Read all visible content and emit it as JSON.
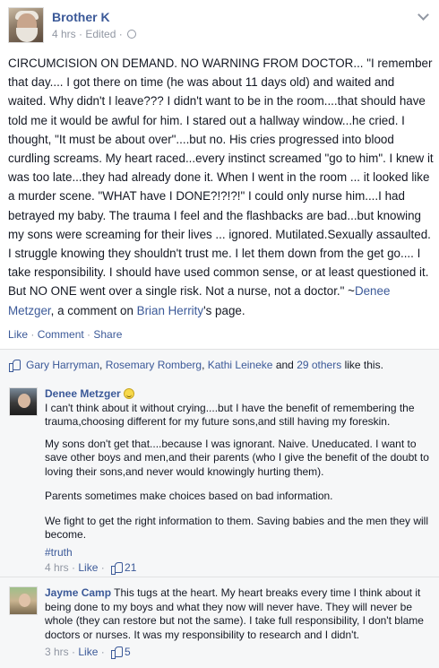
{
  "post": {
    "author": "Brother K",
    "time": "4 hrs",
    "edited": "Edited",
    "body_main": "CIRCUMCISION ON DEMAND. NO WARNING FROM DOCTOR... \"I remember that day.... I got there on time (he was about 11 days old) and waited and waited. Why didn't I leave??? I didn't want to be in the room....that should have told me it would be awful for him. I stared out a hallway window...he cried. I thought, \"It must be about over\"....but no. His cries progressed into blood curdling screams. My heart raced...every instinct screamed \"go to him\". I knew it was too late...they had already done it. When I went in the room ... it looked like a murder scene. \"WHAT have I DONE?!?!?!\" I could only nurse him....I had betrayed my baby. The trauma I feel and the flashbacks are bad...but knowing my sons were screaming for their lives ... ignored. Mutilated.Sexually assaulted. I struggle knowing they shouldn't trust me. I let them down from the get go.... I take responsibility. I should have used common sense, or at least questioned it. But NO ONE went over a single risk. Not a nurse, not a doctor.\" ~",
    "quote_author": "Denee Metzger",
    "body_mid": ", a comment on ",
    "page_owner": "Brian Herrity",
    "body_end": "'s page.",
    "actions": {
      "like": "Like",
      "comment": "Comment",
      "share": "Share"
    }
  },
  "likes": {
    "names": [
      "Gary Harryman",
      "Rosemary Romberg",
      "Kathi Leineke"
    ],
    "others": "29 others",
    "suffix": "like this.",
    "and": "and"
  },
  "comments": [
    {
      "name": "Denee Metzger",
      "paragraphs": [
        "I can't think about it without crying....but I have the benefit of remembering the trauma,choosing different for my future sons,and still having my foreskin.",
        "My sons don't get that....because I was ignorant. Naive. Uneducated. I want to save other boys and men,and their parents (who I give the benefit of the doubt to loving their sons,and never would knowingly hurting them).",
        "Parents sometimes make choices based on bad information.",
        "We fight to get the right information to them. Saving babies and the men they will become."
      ],
      "hashtag": "#truth",
      "time": "4 hrs",
      "like": "Like",
      "like_count": "21"
    },
    {
      "name": "Jayme Camp",
      "text": "This tugs at the heart. My heart breaks every time I think about it being done to my boys and what they now will never have. They will never be whole (they can restore but not the same). I take full responsibility, I don't blame doctors or nurses. It was my responsibility to research and I didn't.",
      "time": "3 hrs",
      "like": "Like",
      "like_count": "5"
    }
  ],
  "colors": {
    "link": "#3b5998",
    "meta": "#9197a3",
    "panel": "#f6f7f8"
  }
}
